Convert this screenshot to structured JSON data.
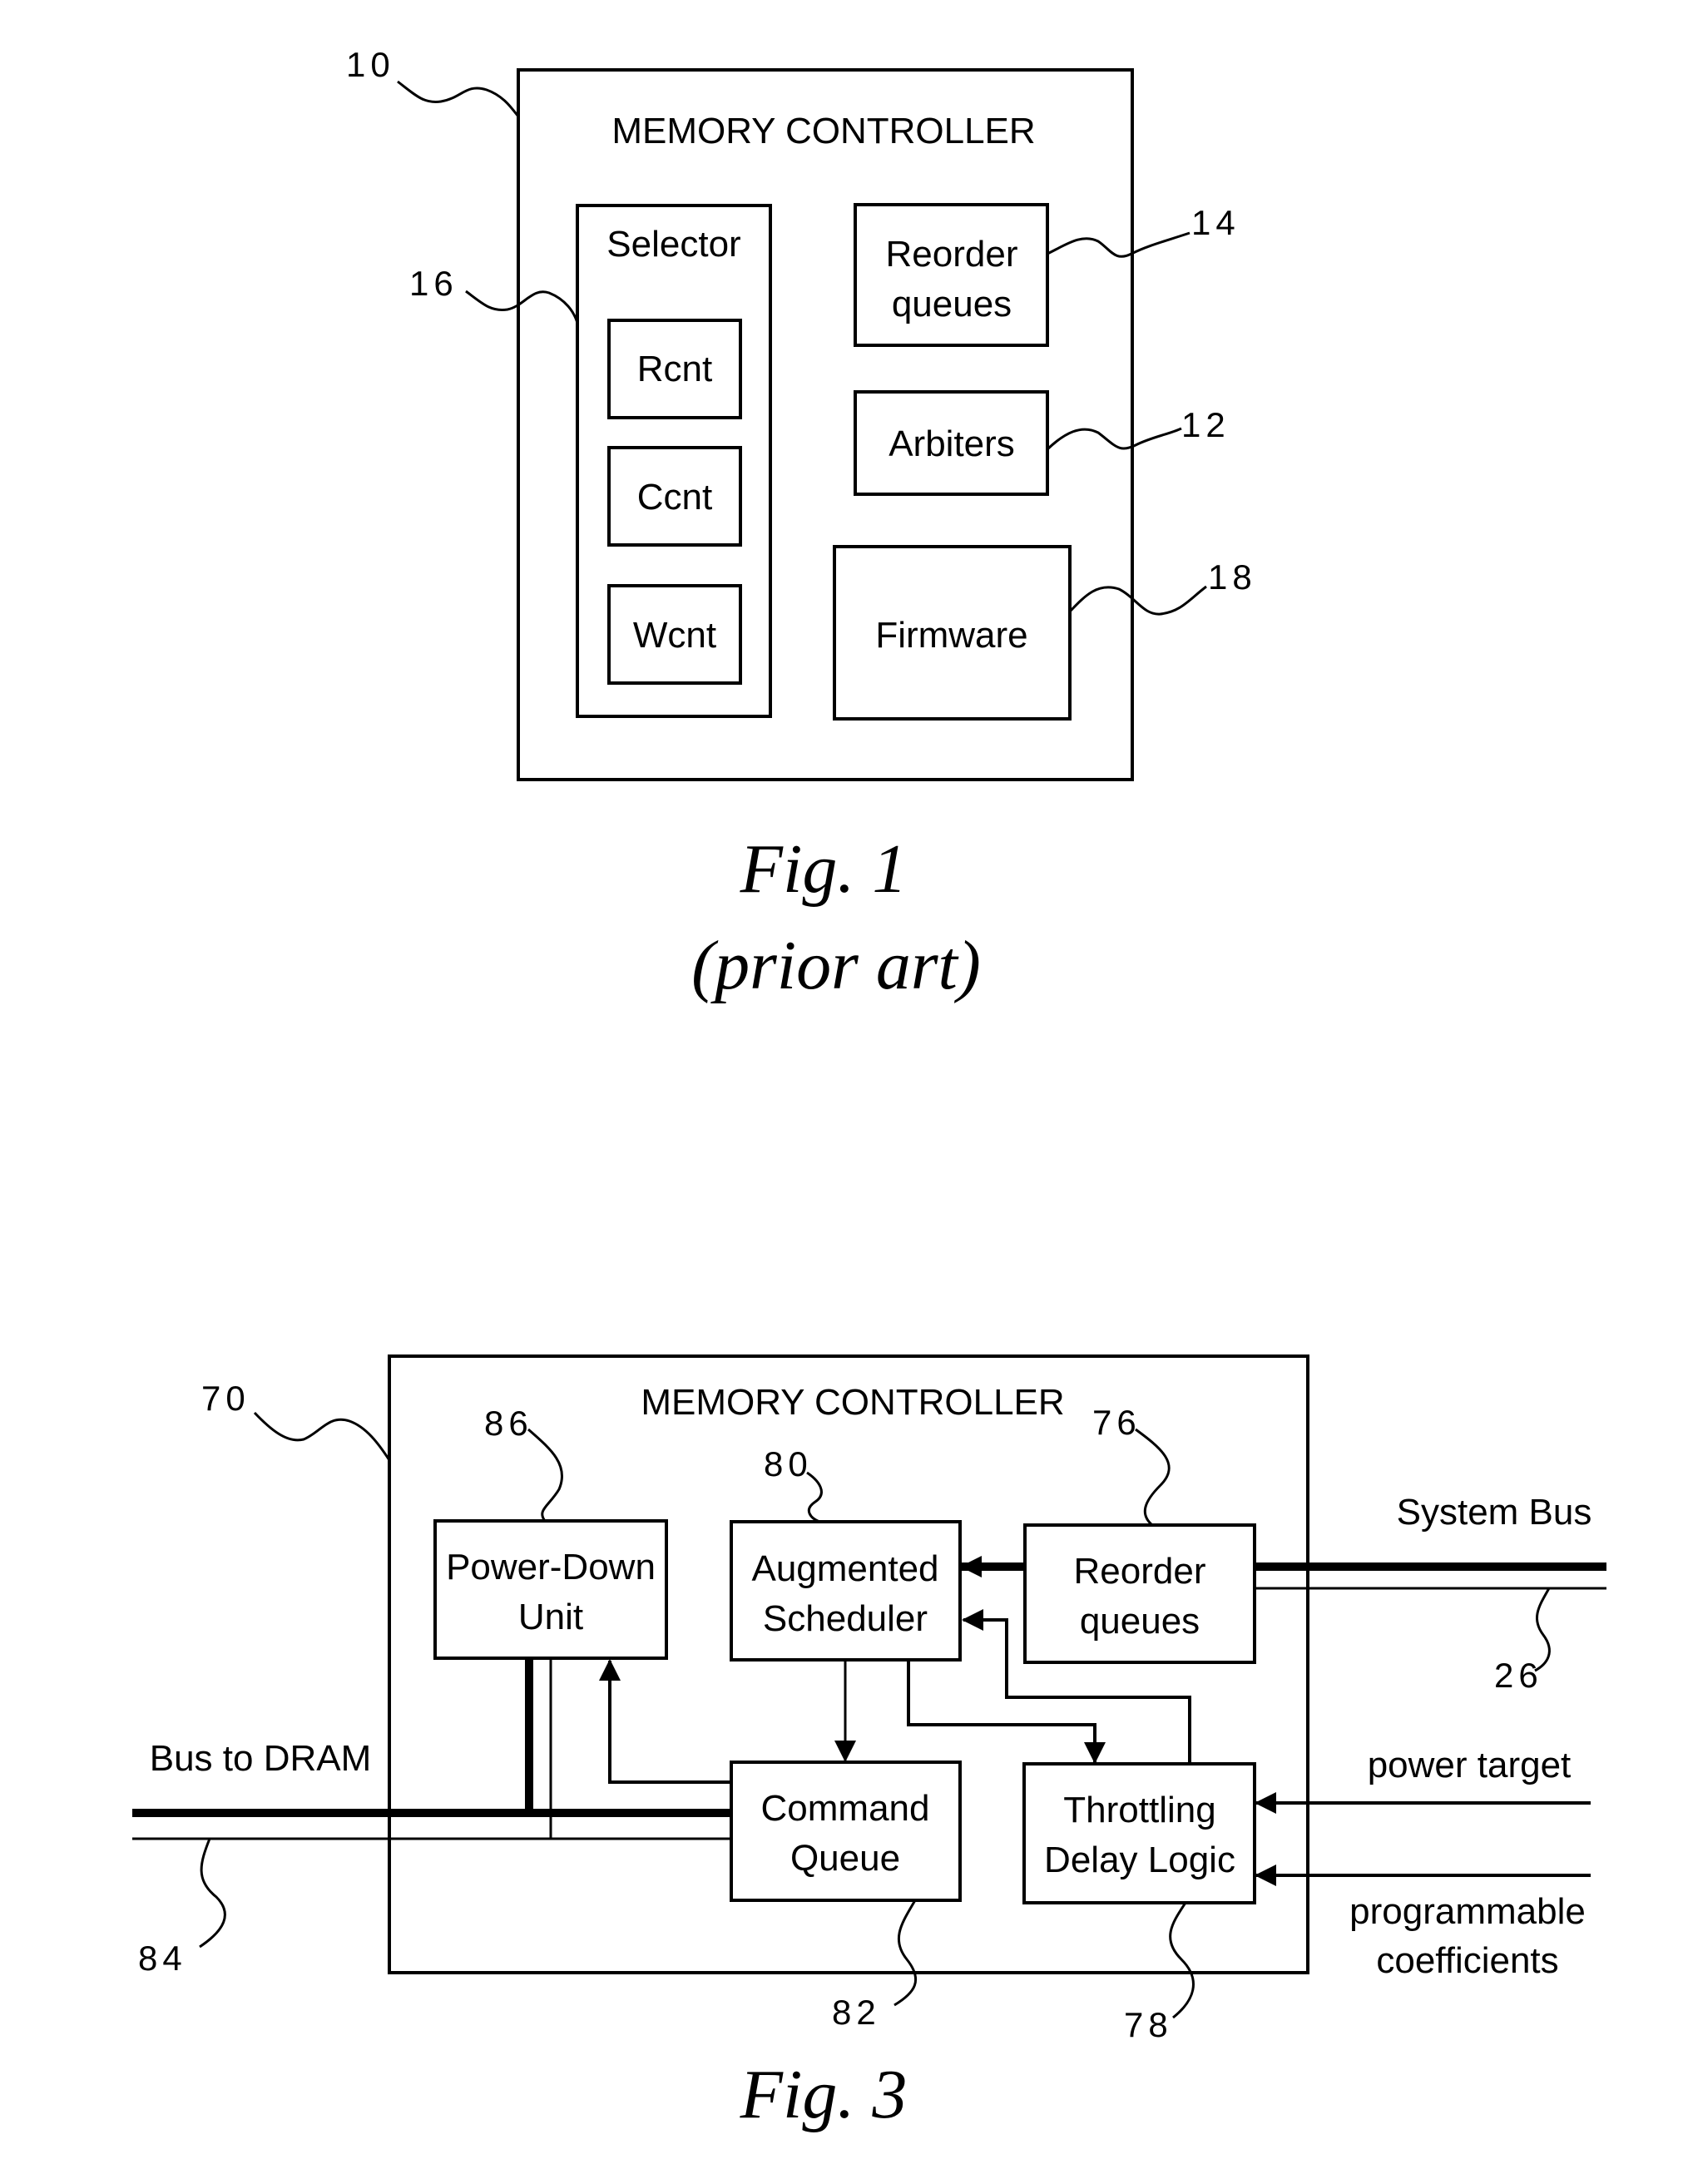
{
  "figures": [
    {
      "caption": "Fig. 1",
      "subcaption": "(prior art)",
      "title": "MEMORY CONTROLLER",
      "refs": {
        "controller": "10",
        "selector": "16",
        "reorder": "14",
        "arbiters": "12",
        "firmware": "18"
      },
      "blocks": {
        "selector": "Selector",
        "rcnt": "Rcnt",
        "ccnt": "Ccnt",
        "wcnt": "Wcnt",
        "reorder": [
          "Reorder",
          "queues"
        ],
        "arbiters": "Arbiters",
        "firmware": "Firmware"
      }
    },
    {
      "caption": "Fig. 3",
      "title": "MEMORY CONTROLLER",
      "refs": {
        "controller": "70",
        "powerdown": "86",
        "scheduler": "80",
        "reorder": "76",
        "systembus": "26",
        "dram": "84",
        "cmdqueue": "82",
        "throttle": "78"
      },
      "blocks": {
        "powerdown": [
          "Power-Down",
          "Unit"
        ],
        "scheduler": [
          "Augmented",
          "Scheduler"
        ],
        "reorder": [
          "Reorder",
          "queues"
        ],
        "cmdqueue": [
          "Command",
          "Queue"
        ],
        "throttle": [
          "Throttling",
          "Delay Logic"
        ]
      },
      "signals": {
        "system_bus": "System Bus",
        "bus_to_dram": "Bus to DRAM",
        "power_target": "power target",
        "coefficients": [
          "programmable",
          "coefficients"
        ]
      }
    }
  ]
}
